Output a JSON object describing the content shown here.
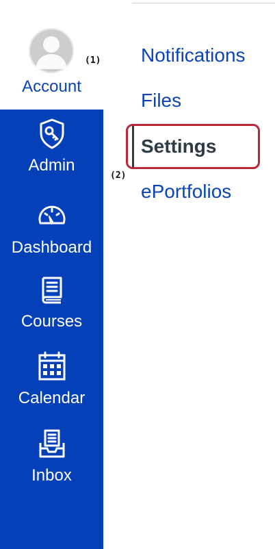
{
  "nav": {
    "account": {
      "label": "Account",
      "marker": "(1)"
    },
    "items": [
      {
        "label": "Admin",
        "icon": "shield-key-icon",
        "marker": "(2)"
      },
      {
        "label": "Dashboard",
        "icon": "dashboard-gauge-icon"
      },
      {
        "label": "Courses",
        "icon": "book-icon"
      },
      {
        "label": "Calendar",
        "icon": "calendar-icon"
      },
      {
        "label": "Inbox",
        "icon": "inbox-icon"
      }
    ],
    "colors": {
      "nav_background": "#0441b9",
      "link": "#0b44b8",
      "active_text": "#2d3b45",
      "highlight": "#b8283a"
    }
  },
  "tray": {
    "links": [
      "Notifications",
      "Files",
      "Settings",
      "ePortfolios"
    ],
    "active": "Settings"
  }
}
